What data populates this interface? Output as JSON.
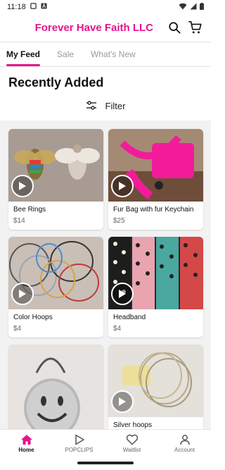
{
  "status_bar": {
    "time": "11:18"
  },
  "header": {
    "shop_name": "Forever Have Faith LLC"
  },
  "tabs": [
    {
      "label": "My Feed",
      "active": true
    },
    {
      "label": "Sale",
      "active": false
    },
    {
      "label": "What's New",
      "active": false
    }
  ],
  "section": {
    "title": "Recently Added"
  },
  "filter": {
    "label": "Filter"
  },
  "products": [
    {
      "name": "Bee Rings",
      "price": "$14"
    },
    {
      "name": "Fur Bag with fur Keychain",
      "price": "$25"
    },
    {
      "name": "Color Hoops",
      "price": "$4"
    },
    {
      "name": "Headband",
      "price": "$4"
    },
    {
      "name": "",
      "price": ""
    },
    {
      "name": "Silver hoops",
      "price": ""
    }
  ],
  "bottom_nav": [
    {
      "label": "Home",
      "icon": "home-icon",
      "active": true
    },
    {
      "label": "POPCLIPS",
      "icon": "play-icon",
      "active": false
    },
    {
      "label": "Waitlist",
      "icon": "heart-icon",
      "active": false
    },
    {
      "label": "Account",
      "icon": "person-icon",
      "active": false
    }
  ],
  "colors": {
    "accent": "#e5148c",
    "feed_background": "#f2f2f2"
  }
}
